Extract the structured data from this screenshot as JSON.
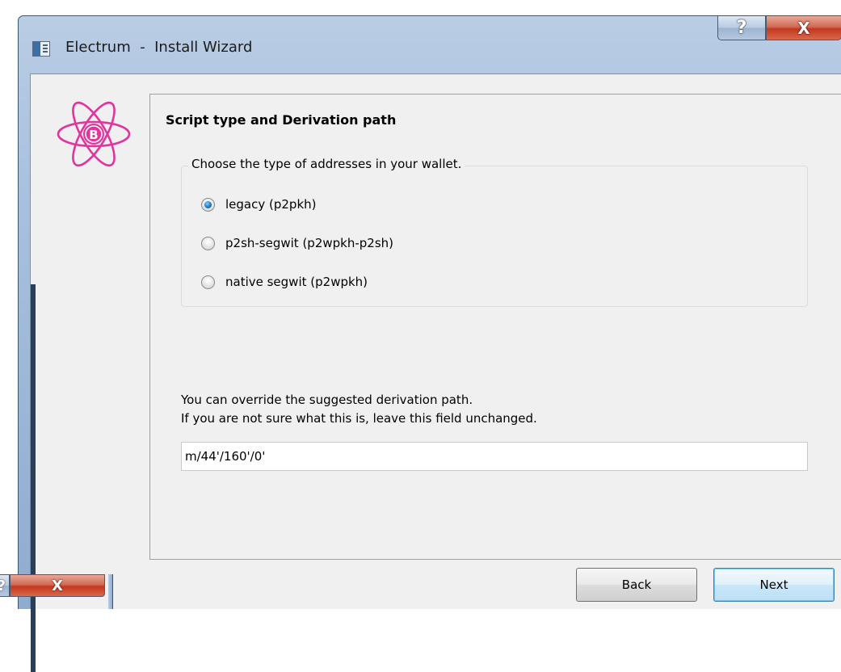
{
  "window": {
    "title": "Electrum  -  Install Wizard",
    "help_glyph": "?",
    "close_glyph": "X",
    "logo_icon": "electrum-atom-logo-icon",
    "accent_color": "#e0359f"
  },
  "wizard": {
    "page_title": "Script type and Derivation path",
    "group_title": "Choose the type of addresses in your wallet.",
    "options": [
      {
        "label": "legacy (p2pkh)",
        "checked": true
      },
      {
        "label": "p2sh-segwit (p2wpkh-p2sh)",
        "checked": false
      },
      {
        "label": "native segwit (p2wpkh)",
        "checked": false
      }
    ],
    "info_line_1": "You can override the suggested derivation path.",
    "info_line_2": "If you are not sure what this is, leave this field unchanged.",
    "derivation_path": "m/44'/160'/0'"
  },
  "buttons": {
    "back": "Back",
    "next": "Next"
  },
  "ghost_window": {
    "help_glyph": "?",
    "close_glyph": "X"
  }
}
